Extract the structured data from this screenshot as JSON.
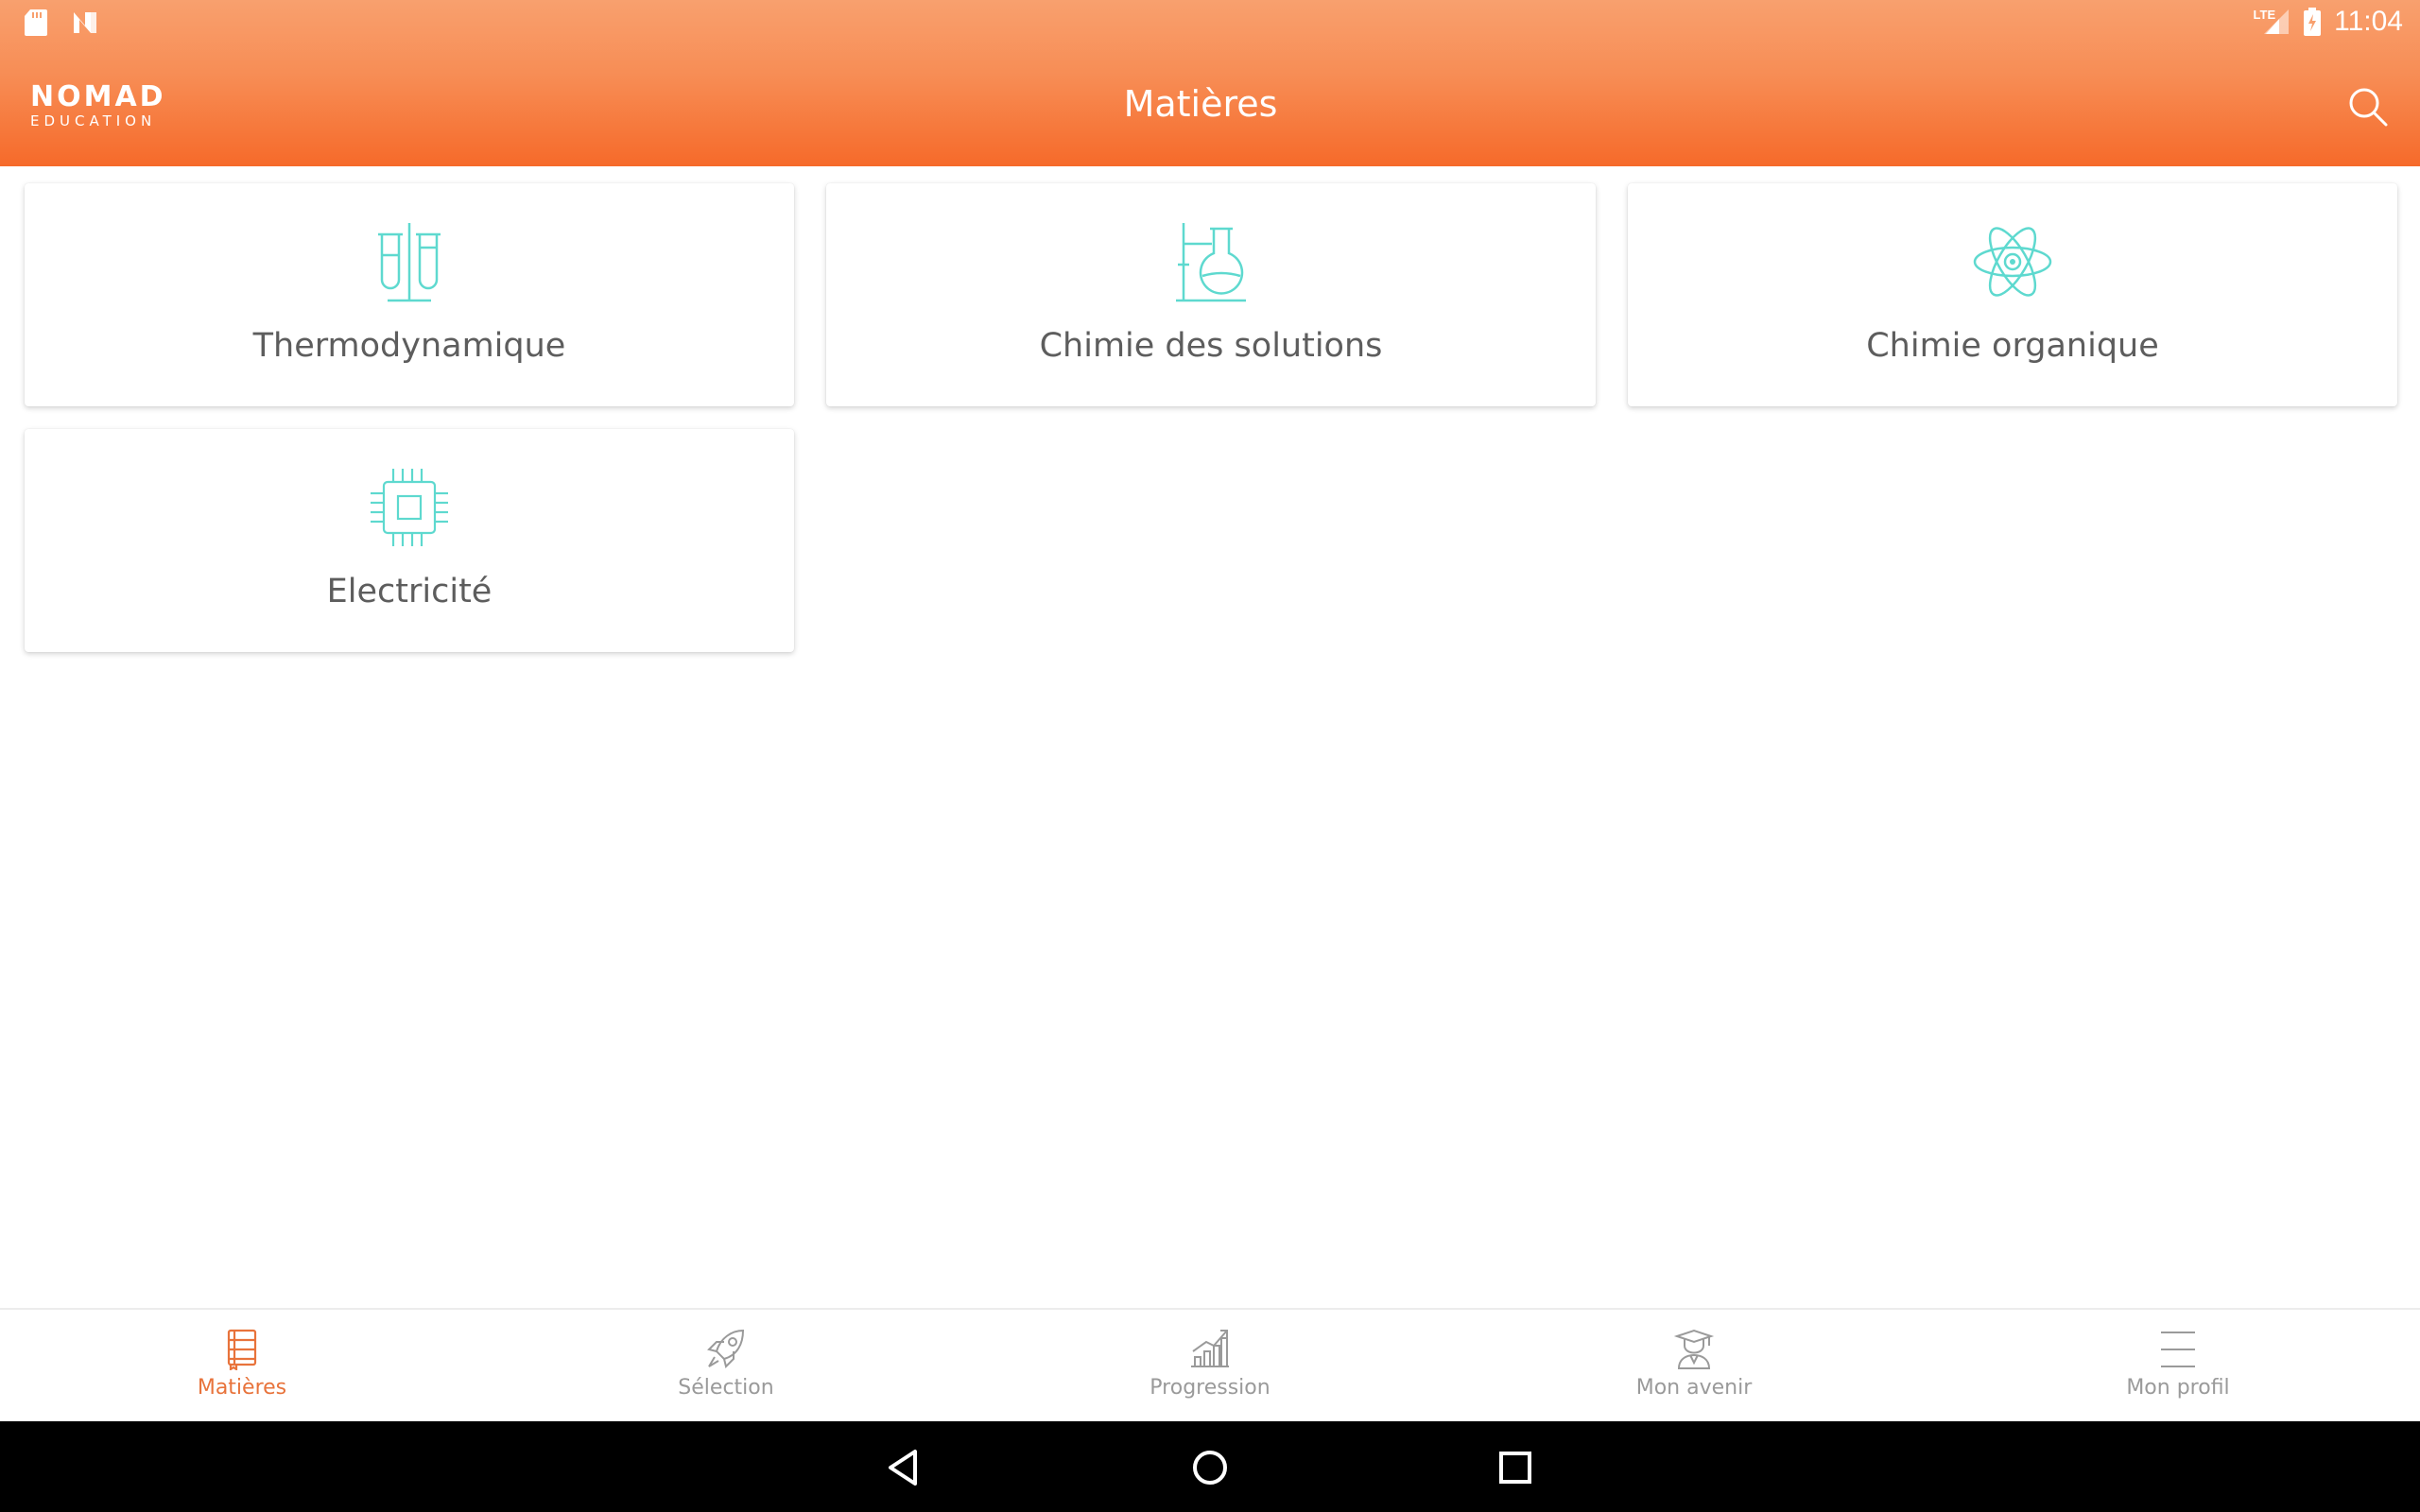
{
  "status_bar": {
    "time": "11:04",
    "network_label": "LTE",
    "left_icons": [
      "sd-card-icon",
      "n-notification-icon"
    ],
    "right_icons": [
      "signal-icon",
      "battery-icon"
    ]
  },
  "app_bar": {
    "logo_main": "NOMAD",
    "logo_sub": "EDUCATION",
    "title": "Matières",
    "search_icon": "search-icon"
  },
  "subjects": [
    {
      "label": "Thermodynamique",
      "icon": "test-tubes-icon"
    },
    {
      "label": "Chimie des solutions",
      "icon": "flask-stand-icon"
    },
    {
      "label": "Chimie organique",
      "icon": "atom-icon"
    },
    {
      "label": "Electricité",
      "icon": "chip-icon"
    }
  ],
  "bottom_nav": {
    "items": [
      {
        "label": "Matières",
        "icon": "book-icon",
        "active": true
      },
      {
        "label": "Sélection",
        "icon": "rocket-icon",
        "active": false
      },
      {
        "label": "Progression",
        "icon": "chart-icon",
        "active": false
      },
      {
        "label": "Mon avenir",
        "icon": "graduate-icon",
        "active": false
      },
      {
        "label": "Mon profil",
        "icon": "menu-icon",
        "active": false
      }
    ]
  },
  "colors": {
    "accent": "#f66a2a",
    "accent_light": "#f8a06e",
    "icon_teal": "#5ed9cf",
    "nav_active": "#e8733b",
    "nav_inactive": "#9a9a9a"
  }
}
